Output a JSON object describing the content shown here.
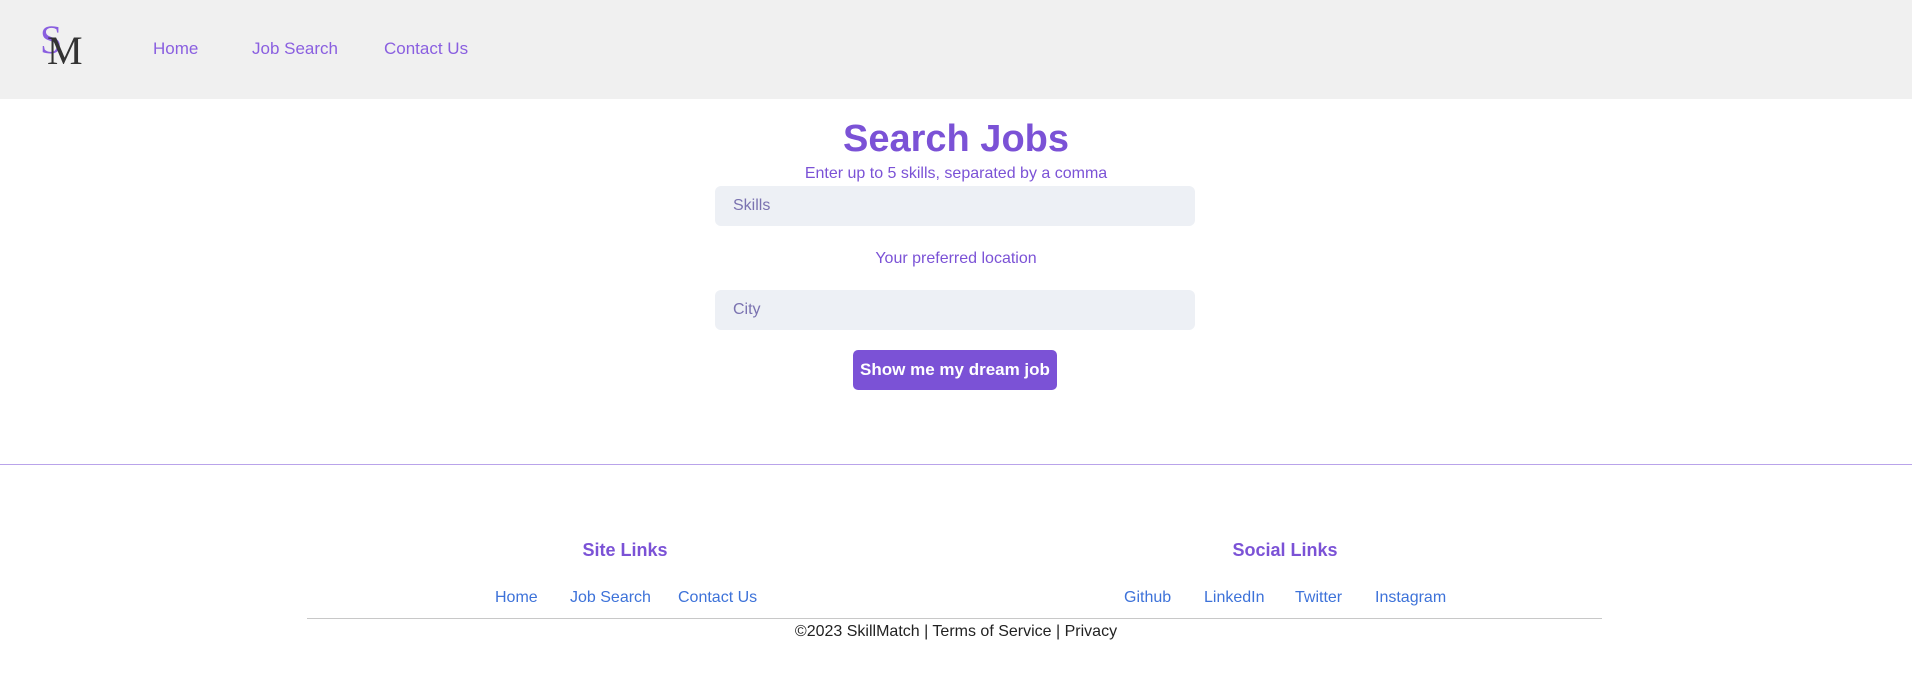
{
  "logo": {
    "s": "S",
    "m": "M"
  },
  "nav": {
    "home": "Home",
    "job_search": "Job Search",
    "contact_us": "Contact Us"
  },
  "main": {
    "title": "Search Jobs",
    "skills_hint": "Enter up to 5 skills, separated by a comma",
    "skills_placeholder": "Skills",
    "location_label": "Your preferred location",
    "city_placeholder": "City",
    "submit_label": "Show me my dream job"
  },
  "footer": {
    "site_links_heading": "Site Links",
    "site_links": [
      "Home",
      "Job Search",
      "Contact Us"
    ],
    "social_links_heading": "Social Links",
    "social_links": [
      "Github",
      "LinkedIn",
      "Twitter",
      "Instagram"
    ],
    "copyright": "©2023 SkillMatch",
    "separator": "|",
    "terms": "Terms of Service",
    "privacy": "Privacy"
  },
  "colors": {
    "accent": "#7b52d6",
    "nav_bg": "#f0f0f0",
    "link": "#3d72d9"
  }
}
